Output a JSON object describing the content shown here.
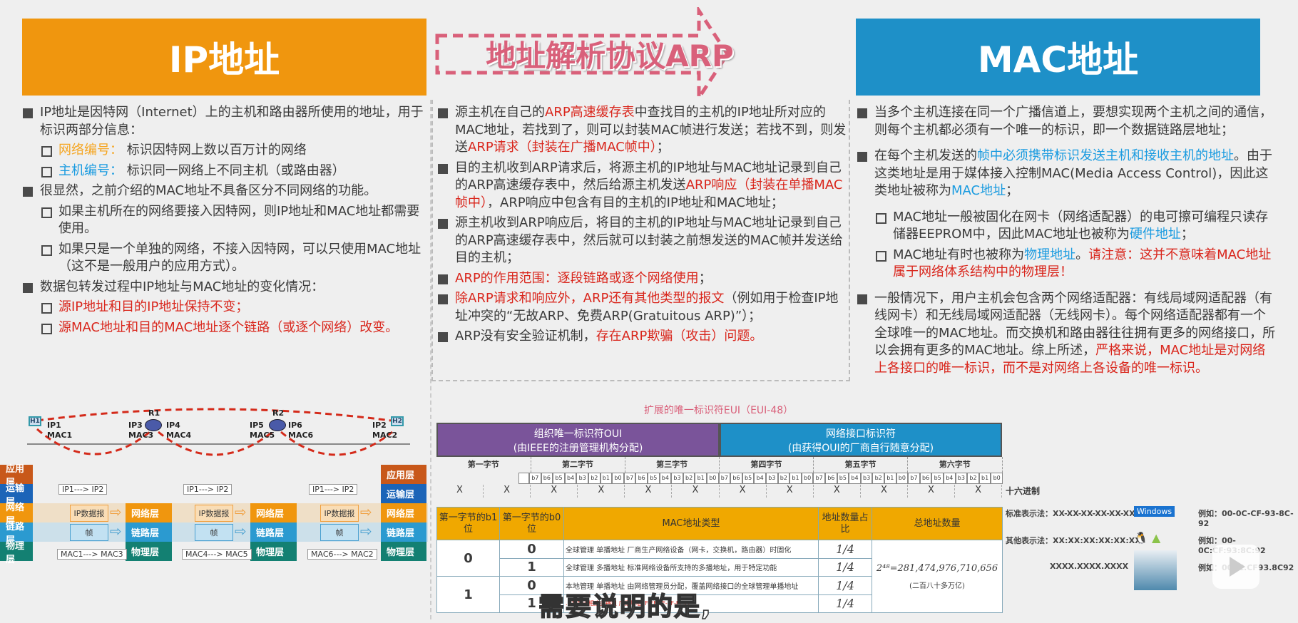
{
  "headers": {
    "ip": "IP地址",
    "arp": "地址解析协议ARP",
    "mac": "MAC地址"
  },
  "colors": {
    "ip": "#f0960e",
    "mac": "#1e90c8",
    "arp": "#d9607a",
    "red": "#d9261c"
  },
  "left": [
    {
      "lvl": 1,
      "segs": [
        {
          "t": "IP地址是因特网（Internet）上的主机和路由器所使用的地址，用于标识两部分信息："
        }
      ]
    },
    {
      "lvl": 2,
      "segs": [
        {
          "t": "网络编号：",
          "c": "org"
        },
        {
          "t": " 标识因特网上数以百万计的网络"
        }
      ]
    },
    {
      "lvl": 2,
      "segs": [
        {
          "t": "主机编号：",
          "c": "blu"
        },
        {
          "t": " 标识同一网络上不同主机（或路由器）"
        }
      ]
    },
    {
      "lvl": 1,
      "segs": [
        {
          "t": "很显然，之前介绍的MAC地址不具备区分不同网络的功能。"
        }
      ]
    },
    {
      "lvl": 2,
      "segs": [
        {
          "t": "如果主机所在的网络要接入因特网，则IP地址和MAC地址都需要使用。"
        }
      ]
    },
    {
      "lvl": 2,
      "segs": [
        {
          "t": "如果只是一个单独的网络，不接入因特网，可以只使用MAC地址（这不是一般用户的应用方式）。"
        }
      ]
    },
    {
      "lvl": 1,
      "segs": [
        {
          "t": "数据包转发过程中IP地址与MAC地址的变化情况："
        }
      ]
    },
    {
      "lvl": 2,
      "segs": [
        {
          "t": "源IP地址和目的IP地址保持不变；",
          "c": "red"
        }
      ]
    },
    {
      "lvl": 2,
      "segs": [
        {
          "t": "源MAC地址和目的MAC地址逐个链路（或逐个网络）改变。",
          "c": "red"
        }
      ]
    }
  ],
  "middle": [
    {
      "lvl": 1,
      "segs": [
        {
          "t": "源主机在自己的"
        },
        {
          "t": "ARP高速缓存表",
          "c": "red"
        },
        {
          "t": "中查找目的主机的IP地址所对应的MAC地址，若找到了，则可以封装MAC帧进行发送；若找不到，则发送"
        },
        {
          "t": "ARP请求（封装在广播MAC帧中）",
          "c": "red"
        },
        {
          "t": "；"
        }
      ]
    },
    {
      "lvl": 1,
      "segs": [
        {
          "t": "目的主机收到ARP请求后，将源主机的IP地址与MAC地址记录到自己的ARP高速缓存表中，然后给源主机发送"
        },
        {
          "t": "ARP响应（封装在单播MAC帧中）",
          "c": "red"
        },
        {
          "t": "，ARP响应中包含有目的主机的IP地址和MAC地址；"
        }
      ]
    },
    {
      "lvl": 1,
      "segs": [
        {
          "t": "源主机收到ARP响应后，将目的主机的IP地址与MAC地址记录到自己的ARP高速缓存表中，然后就可以封装之前想发送的MAC帧并发送给目的主机；"
        }
      ]
    },
    {
      "lvl": 1,
      "segs": [
        {
          "t": "ARP的作用范围：逐段链路或逐个网络使用",
          "c": "red"
        },
        {
          "t": "；"
        }
      ]
    },
    {
      "lvl": 1,
      "segs": [
        {
          "t": "除ARP请求和响应外，ARP还有其他类型的报文",
          "c": "red"
        },
        {
          "t": "（例如用于检查IP地址冲突的“无故ARP、免费ARP(Gratuitous ARP)”）；"
        }
      ]
    },
    {
      "lvl": 1,
      "segs": [
        {
          "t": "ARP没有安全验证机制，"
        },
        {
          "t": "存在ARP欺骗（攻击）问题。",
          "c": "red"
        }
      ]
    }
  ],
  "right": [
    {
      "lvl": 1,
      "segs": [
        {
          "t": "当多个主机连接在同一个广播信道上，要想实现两个主机之间的通信，则每个主机都必须有一个唯一的标识，即一个数据链路层地址；"
        }
      ]
    },
    {
      "lvl": 1,
      "segs": [
        {
          "t": "在每个主机发送的"
        },
        {
          "t": "帧中必须携带标识发送主机和接收主机的地址",
          "c": "blu"
        },
        {
          "t": "。由于这类地址是用于媒体接入控制MAC(Media Access Control)，因此这类地址被称为"
        },
        {
          "t": "MAC地址",
          "c": "blu"
        },
        {
          "t": "；"
        }
      ]
    },
    {
      "lvl": 2,
      "segs": [
        {
          "t": "MAC地址一般被固化在网卡（网络适配器）的电可擦可编程只读存储器EEPROM中，因此MAC地址也被称为"
        },
        {
          "t": "硬件地址",
          "c": "blu"
        },
        {
          "t": "；"
        }
      ]
    },
    {
      "lvl": 2,
      "segs": [
        {
          "t": "MAC地址有时也被称为"
        },
        {
          "t": "物理地址",
          "c": "blu"
        },
        {
          "t": "。"
        },
        {
          "t": "请注意：这并不意味着MAC地址属于网络体系结构中的物理层！",
          "c": "red"
        }
      ]
    },
    {
      "lvl": 1,
      "segs": [
        {
          "t": "一般情况下，用户主机会包含两个网络适配器：有线局域网适配器（有线网卡）和无线局域网适配器（无线网卡）。每个网络适配器都有一个全球唯一的MAC地址。而交换机和路由器往往拥有更多的网络接口，所以会拥有更多的MAC地址。综上所述，"
        },
        {
          "t": "严格来说，MAC地址是对网络上各接口的唯一标识，而不是对网络上各设备的唯一标识。",
          "c": "red"
        }
      ]
    }
  ],
  "diagram": {
    "hosts": [
      "H1",
      "H2"
    ],
    "routers": [
      "R1",
      "R2"
    ],
    "addrs": [
      [
        "IP1",
        "MAC1"
      ],
      [
        "IP3",
        "MAC3"
      ],
      [
        "IP4",
        "MAC4"
      ],
      [
        "IP5",
        "MAC5"
      ],
      [
        "IP6",
        "MAC6"
      ],
      [
        "IP2",
        "MAC2"
      ]
    ],
    "layers": [
      "应用层",
      "运输层",
      "网络层",
      "链路层",
      "物理层"
    ],
    "ip_label": "IP1---> IP2",
    "packet": "IP数据报",
    "frame": "帧",
    "mac_labels": [
      "MAC1---> MAC3",
      "MAC4---> MAC5",
      "MAC6---> MAC2"
    ]
  },
  "eui": {
    "title": "扩展的唯一标识符EUI（EUI-48）",
    "oui": [
      "组织唯一标识符OUI",
      "(由IEEE的注册管理机构分配)"
    ],
    "nic": [
      "网络接口标识符",
      "(由获得OUI的厂商自行随意分配)"
    ],
    "bytes": [
      "第一字节",
      "第二字节",
      "第三字节",
      "第四字节",
      "第五字节",
      "第六字节"
    ],
    "bits": [
      "b7",
      "b6",
      "b5",
      "b4",
      "b3",
      "b2",
      "b1",
      "b0"
    ],
    "x": "X",
    "hex_label": "十六进制"
  },
  "mac_table": {
    "headers": [
      "第一字节的b1位",
      "第一字节的b0位",
      "MAC地址类型",
      "地址数量占比",
      "总地址数量"
    ],
    "b1": [
      "0",
      "1"
    ],
    "rows": [
      {
        "b0": "0",
        "type": "全球管理 单播地址 厂商生产网络设备（网卡，交换机，路由器）时固化",
        "ratio": "1/4"
      },
      {
        "b0": "1",
        "type": "全球管理 多播地址 标准网络设备所支持的多播地址，用于特定功能",
        "ratio": "1/4"
      },
      {
        "b0": "0",
        "type": "本地管理 单播地址 由网络管理员分配，覆盖网络接口的全球管理单播地址",
        "ratio": "1/4"
      },
      {
        "b0": "1",
        "type": "…其属于相应多播组 广播地址FF-FF-FF-FF-FF-FF",
        "ratio": "1/4"
      }
    ],
    "total": "2⁴⁸=281,474,976,710,656",
    "total_note": "(二百八十多万亿)"
  },
  "notations": [
    {
      "label": "标准表示法：XX-XX-XX-XX-XX-XX",
      "os": "Windows",
      "example": "例如：00-0C-CF-93-8C-92"
    },
    {
      "label": "其他表示法：XX:XX:XX:XX:XX:XX",
      "example": "例如：00-0C:CF:93:8C:92"
    },
    {
      "label": "XXXX.XXXX.XXXX",
      "example": "例如：000C.CF93.8C92"
    }
  ],
  "subtitle": "需要说明的是,"
}
